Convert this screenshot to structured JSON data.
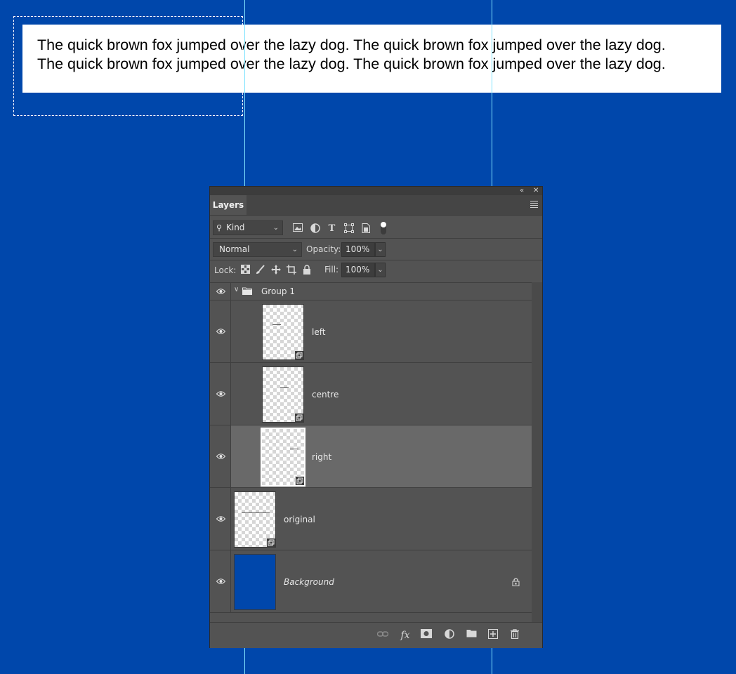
{
  "canvas": {
    "background_color": "#0047ab",
    "text_lines": [
      "The quick brown fox jumped over the lazy dog. The quick brown fox jumped over the lazy dog.",
      "The quick brown fox jumped over the lazy dog. The quick brown fox jumped over the lazy dog."
    ]
  },
  "panel": {
    "tab_label": "Layers",
    "collapse_icon": "double-chevron-left-icon",
    "close_icon": "close-icon",
    "filter": {
      "kind_label": "Kind",
      "icons": [
        "image-filter-icon",
        "adjustment-filter-icon",
        "type-filter-icon",
        "shape-filter-icon",
        "smart-object-filter-icon",
        "filter-toggle-icon"
      ]
    },
    "blend": {
      "mode": "Normal",
      "opacity_label": "Opacity:",
      "opacity_value": "100%"
    },
    "lock": {
      "label": "Lock:",
      "fill_label": "Fill:",
      "fill_value": "100%"
    },
    "layers": [
      {
        "name": "Group 1",
        "type": "group",
        "selected": false
      },
      {
        "name": "left",
        "type": "smart-object",
        "selected": false
      },
      {
        "name": "centre",
        "type": "smart-object",
        "selected": false
      },
      {
        "name": "right",
        "type": "smart-object",
        "selected": true
      },
      {
        "name": "original",
        "type": "smart-object",
        "selected": false
      },
      {
        "name": "Background",
        "type": "background",
        "locked": true,
        "selected": false
      }
    ],
    "footer_icons": [
      "link-icon",
      "fx-icon",
      "mask-icon",
      "adjustment-icon",
      "folder-icon",
      "new-layer-icon",
      "trash-icon"
    ]
  },
  "colors": {
    "guide": "#7fe3ff",
    "panel_bg": "#535353",
    "selected_row": "#696969"
  }
}
